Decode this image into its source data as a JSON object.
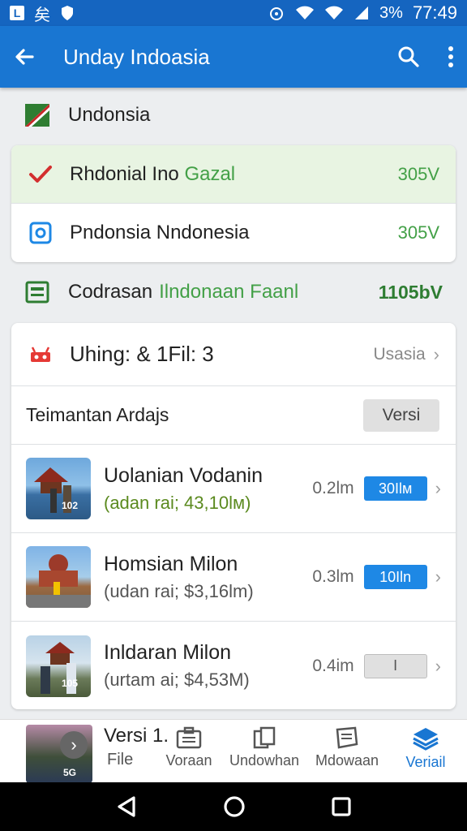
{
  "status_bar": {
    "badge": "L",
    "left_text": "矣",
    "battery": "3%",
    "time": "77:49"
  },
  "app_bar": {
    "title": "Unday Indoasia"
  },
  "country": {
    "label": "Undonsia"
  },
  "summary": [
    {
      "label_main": "Rhdonial Ino",
      "label_accent": "Gazal",
      "value": "305V"
    },
    {
      "label_main": "Pndonsia Nndonesia",
      "label_accent": "",
      "value": "305V"
    }
  ],
  "total": {
    "label_main": "Codrasan",
    "label_accent": "Ilndonaan Faanl",
    "value": "1105bV"
  },
  "filter": {
    "label": "Uhing: & 1Fil: 3",
    "region": "Usasia"
  },
  "section": {
    "title": "Teimantan Ardajs",
    "button": "Versi"
  },
  "items": [
    {
      "title": "Uolanian Vodanin",
      "subtitle": "(adan rai; 43,10lм)",
      "distance": "0.2lm",
      "pill": "30Ilм",
      "thumb_caption": "102"
    },
    {
      "title": "Homsian Milon",
      "subtitle": "(udan rai; $3,16lm)",
      "distance": "0.3lm",
      "pill": "10Iln",
      "thumb_caption": ""
    },
    {
      "title": "Inldaran Milon",
      "subtitle": "(urtam ai; $4,53M)",
      "distance": "0.4im",
      "pill": "I",
      "thumb_caption": "105"
    }
  ],
  "bottom_nav": {
    "peek_title": "Versi 1.",
    "peek_caption": "5G",
    "items": [
      {
        "label": "File"
      },
      {
        "label": "Voraan"
      },
      {
        "label": "Undowhan"
      },
      {
        "label": "Mdowaan"
      },
      {
        "label": "Veriail"
      }
    ]
  },
  "colors": {
    "primary": "#1976d2",
    "accent_green": "#43a047",
    "pill_blue": "#1e88e5"
  }
}
